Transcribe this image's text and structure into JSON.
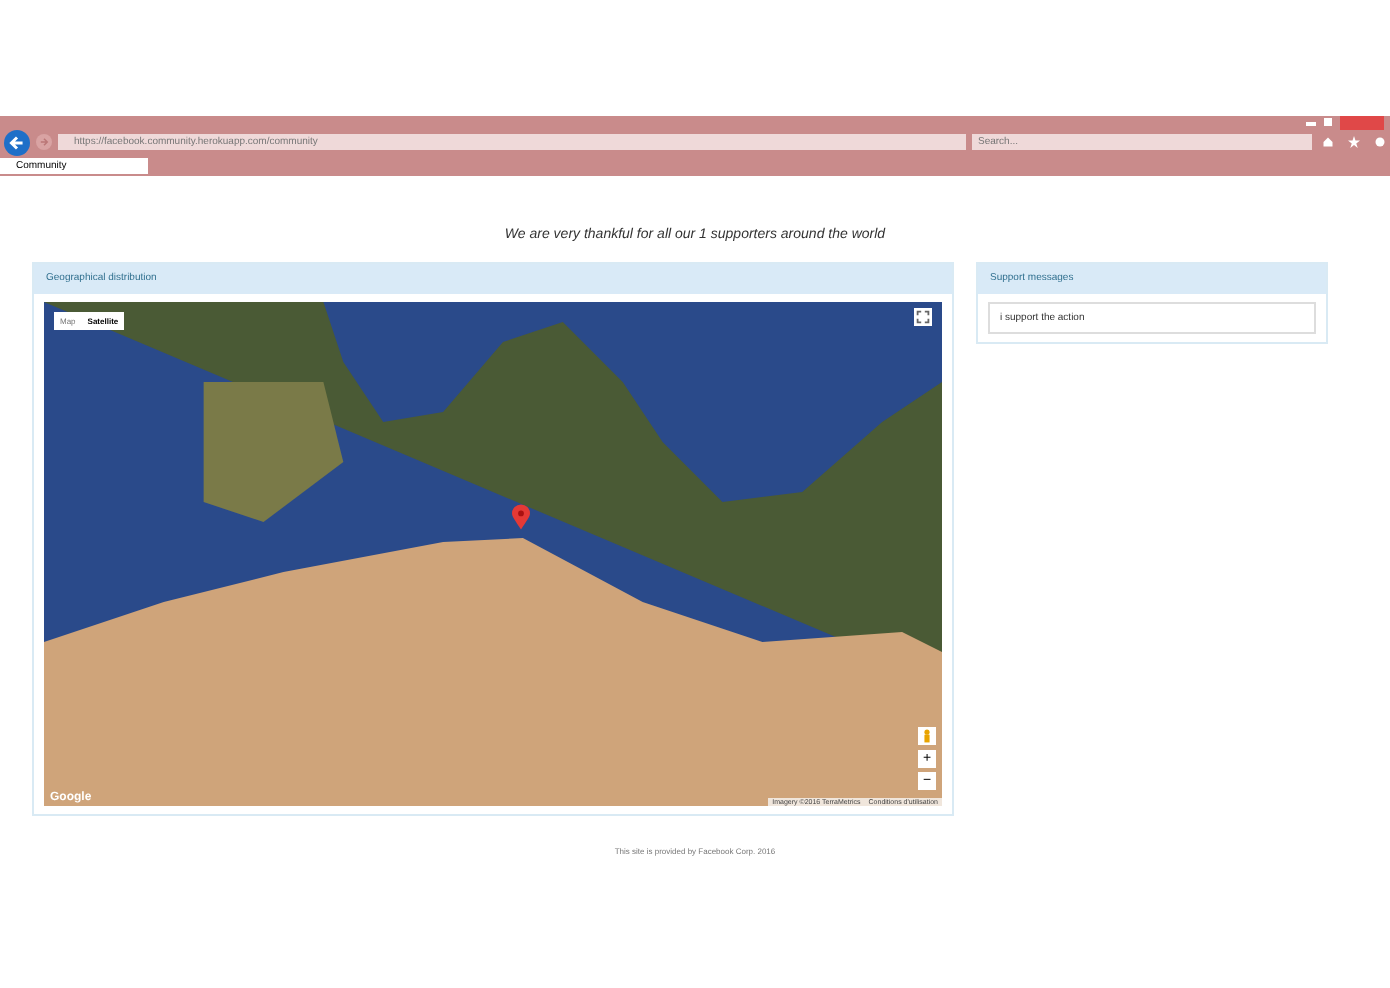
{
  "browser": {
    "url": "https://facebook.community.herokuapp.com/community",
    "search": {
      "placeholder": "Search..."
    },
    "tabs": [
      {
        "label": "Community",
        "selected": true
      }
    ]
  },
  "heading": "We are very thankful for all our 1 supporters around the world",
  "geo_panel": {
    "title": "Geographical distribution",
    "map_types": [
      {
        "label": "Map",
        "selected": false
      },
      {
        "label": "Satellite",
        "selected": true
      }
    ],
    "zoom_in": "+",
    "zoom_out": "−",
    "logo": "Google",
    "attribution": "Imagery ©2016 TerraMetrics",
    "terms": "Conditions d'utilisation"
  },
  "messages_panel": {
    "title": "Support messages",
    "messages": [
      "i support the action"
    ]
  },
  "footer": "This site is provided by Facebook Corp. 2016"
}
